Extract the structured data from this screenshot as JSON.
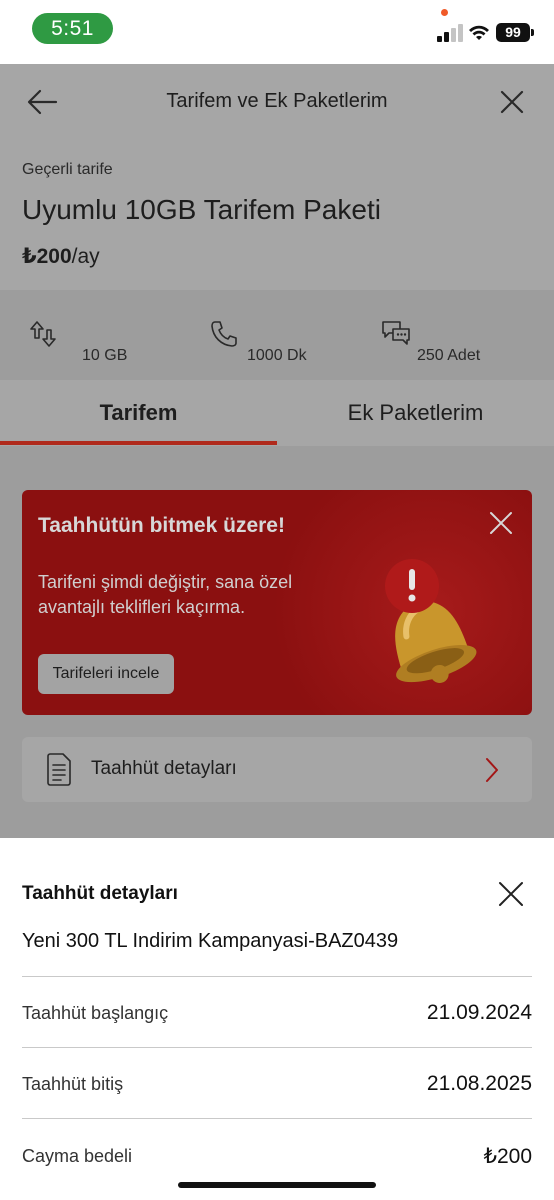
{
  "status_bar": {
    "time": "5:51",
    "battery": "99",
    "time_pill_color": "#2f9a43"
  },
  "header": {
    "title": "Tarifem ve Ek Paketlerim",
    "back_icon": "arrow-left-icon",
    "close_icon": "close-icon",
    "current_label": "Geçerli tarife",
    "plan_name": "Uyumlu 10GB Tarifem Paketi",
    "price_amount": "₺200",
    "price_period": "/ay"
  },
  "stats": [
    {
      "icon": "data-transfer-icon",
      "value": "10 GB"
    },
    {
      "icon": "phone-icon",
      "value": "1000 Dk"
    },
    {
      "icon": "chat-bubbles-icon",
      "value": "250 Adet"
    }
  ],
  "tabs": [
    {
      "label": "Tarifem",
      "active": true
    },
    {
      "label": "Ek Paketlerim",
      "active": false
    }
  ],
  "promo": {
    "title": "Taahhütün bitmek üzere!",
    "text": "Tarifeni şimdi değiştir, sana özel avantajlı teklifleri kaçırma.",
    "button": "Tarifeleri incele",
    "illustration": "bell-alert-icon",
    "background_color": "#8b1010"
  },
  "commitment_row": {
    "label": "Taahhüt detayları",
    "icon": "document-icon"
  },
  "sheet": {
    "title": "Taahhüt detayları",
    "campaign": "Yeni 300 TL Indirim Kampanyasi-BAZ0439",
    "rows": [
      {
        "label": "Taahhüt başlangıç",
        "value": "21.09.2024"
      },
      {
        "label": "Taahhüt bitiş",
        "value": "21.08.2025"
      },
      {
        "label": "Cayma bedeli",
        "value": "₺200"
      }
    ]
  },
  "accent_color": "#e60000"
}
